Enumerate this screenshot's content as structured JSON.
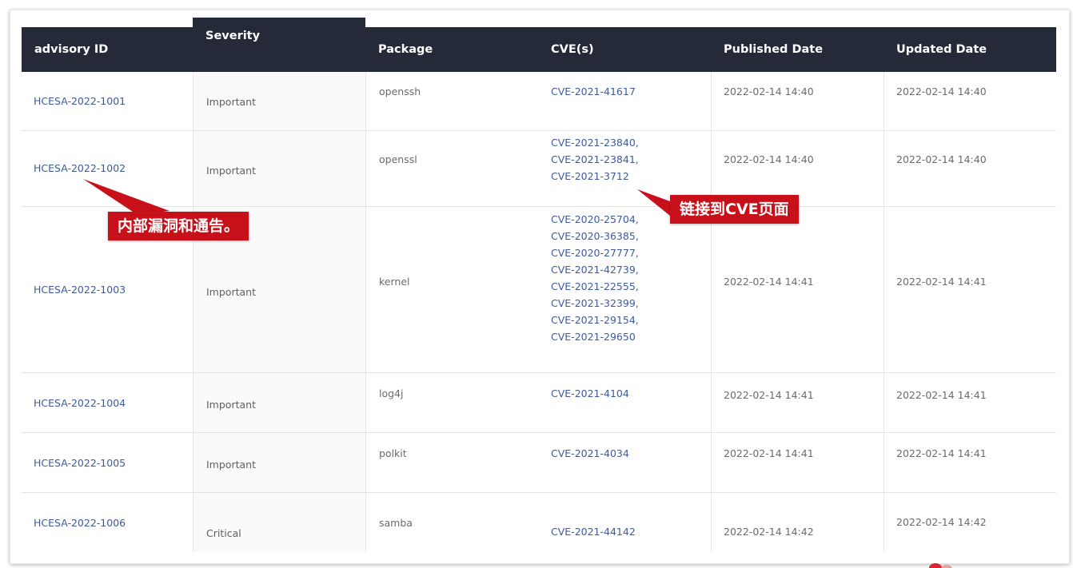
{
  "table": {
    "headers": [
      "advisory ID",
      "Severity",
      "Package",
      "CVE(s)",
      "Published Date",
      "Updated Date"
    ],
    "rows": [
      {
        "id": "HCESA-2022-1001",
        "severity": "Important",
        "package": "openssh",
        "cves": [
          "CVE-2021-41617"
        ],
        "published": "2022-02-14 14:40",
        "updated": "2022-02-14 14:40"
      },
      {
        "id": "HCESA-2022-1002",
        "severity": "Important",
        "package": "openssl",
        "cves": [
          "CVE-2021-23840,",
          "CVE-2021-23841,",
          "CVE-2021-3712"
        ],
        "published": "2022-02-14 14:40",
        "updated": "2022-02-14 14:40"
      },
      {
        "id": "HCESA-2022-1003",
        "severity": "Important",
        "package": "kernel",
        "cves": [
          "CVE-2020-25704,",
          "CVE-2020-36385,",
          "CVE-2020-27777,",
          "CVE-2021-42739,",
          "CVE-2021-22555,",
          "CVE-2021-32399,",
          "CVE-2021-29154,",
          "CVE-2021-29650"
        ],
        "published": "2022-02-14 14:41",
        "updated": "2022-02-14 14:41"
      },
      {
        "id": "HCESA-2022-1004",
        "severity": "Important",
        "package": "log4j",
        "cves": [
          "CVE-2021-4104"
        ],
        "published": "2022-02-14 14:41",
        "updated": "2022-02-14 14:41"
      },
      {
        "id": "HCESA-2022-1005",
        "severity": "Important",
        "package": "polkit",
        "cves": [
          "CVE-2021-4034"
        ],
        "published": "2022-02-14 14:41",
        "updated": "2022-02-14 14:41"
      },
      {
        "id": "HCESA-2022-1006",
        "severity": "Critical",
        "package": "samba",
        "cves": [
          "CVE-2021-44142"
        ],
        "published": "2022-02-14 14:42",
        "updated": "2022-02-14 14:42"
      }
    ]
  },
  "annotations": {
    "advisory_callout": "内部漏洞和通告。",
    "cve_callout": "链接到CVE页面"
  },
  "colors": {
    "header_bg": "#252a38",
    "link": "#3e5a9c",
    "callout_bg": "#c8101a"
  }
}
